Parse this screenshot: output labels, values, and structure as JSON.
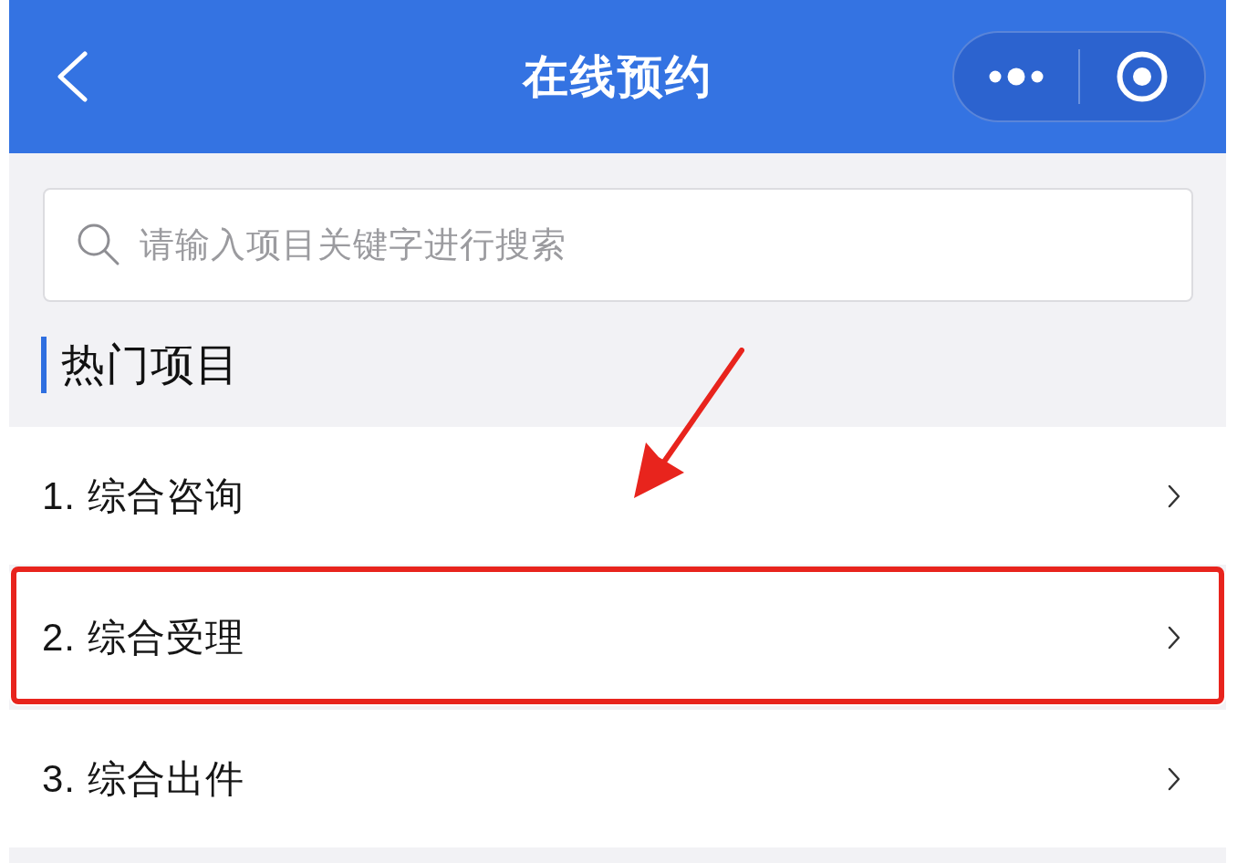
{
  "header": {
    "title": "在线预约"
  },
  "search": {
    "placeholder": "请输入项目关键字进行搜索"
  },
  "section": {
    "title": "热门项目"
  },
  "items": [
    {
      "label": "1. 综合咨询",
      "highlighted": false
    },
    {
      "label": "2. 综合受理",
      "highlighted": true
    },
    {
      "label": "3. 综合出件",
      "highlighted": false
    }
  ]
}
